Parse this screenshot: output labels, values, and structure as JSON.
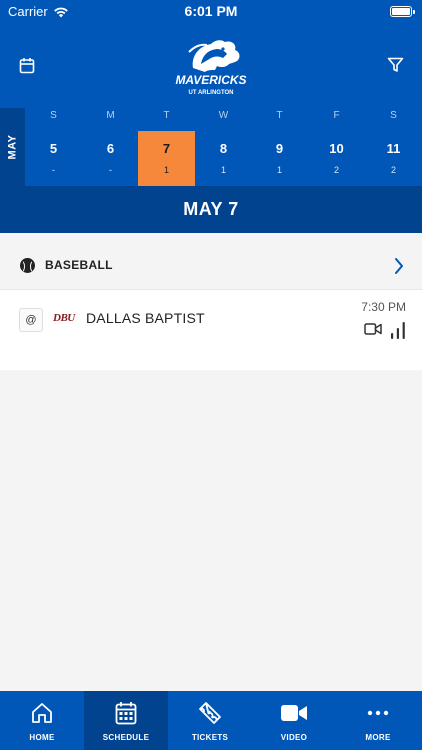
{
  "status_bar": {
    "carrier": "Carrier",
    "time": "6:01 PM"
  },
  "header": {
    "logo_line1": "MAVERICKS",
    "logo_line2": "UT ARLINGTON",
    "calendar_icon": "calendar-icon",
    "filter_icon": "filter-icon"
  },
  "calendar": {
    "month": "MAY",
    "days": [
      {
        "dow": "S",
        "date": "5",
        "count": "-"
      },
      {
        "dow": "M",
        "date": "6",
        "count": "-"
      },
      {
        "dow": "T",
        "date": "7",
        "count": "1"
      },
      {
        "dow": "W",
        "date": "8",
        "count": "1"
      },
      {
        "dow": "T",
        "date": "9",
        "count": "1"
      },
      {
        "dow": "F",
        "date": "10",
        "count": "2"
      },
      {
        "dow": "S",
        "date": "11",
        "count": "2"
      }
    ],
    "selected_index": 2
  },
  "selected_date": "MAY 7",
  "sport": {
    "name": "BASEBALL"
  },
  "game": {
    "location": "@",
    "opponent_logo": "DBU",
    "opponent": "DALLAS BAPTIST",
    "time": "7:30 PM"
  },
  "tabs": [
    {
      "label": "HOME",
      "icon": "home-icon"
    },
    {
      "label": "SCHEDULE",
      "icon": "calendar-icon"
    },
    {
      "label": "TICKETS",
      "icon": "ticket-icon"
    },
    {
      "label": "VIDEO",
      "icon": "video-camera-icon"
    },
    {
      "label": "MORE",
      "icon": "more-dots-icon"
    }
  ],
  "active_tab": 1,
  "colors": {
    "primary": "#0057b8",
    "primary_dark": "#01438f",
    "accent": "#f5883b"
  }
}
